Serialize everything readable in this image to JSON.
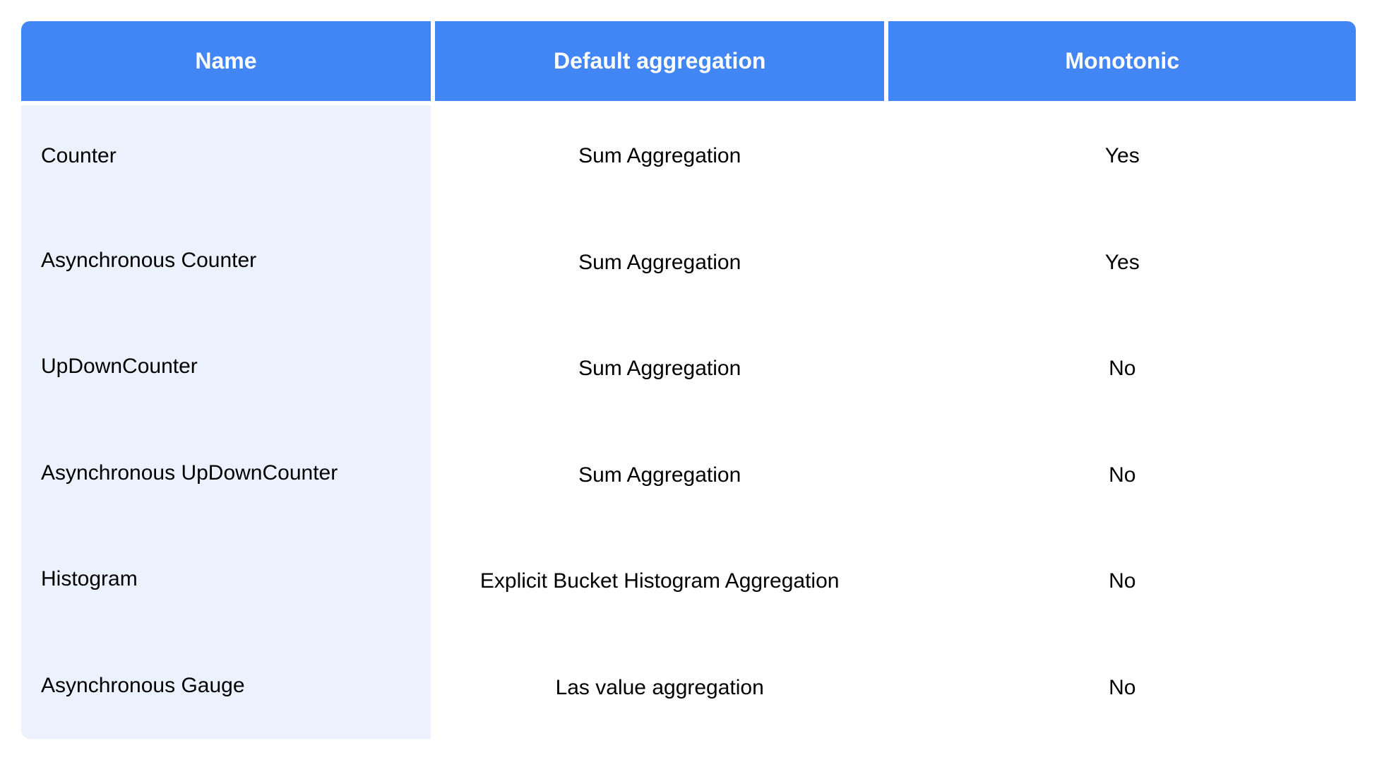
{
  "chart_data": {
    "type": "table",
    "columns": [
      "Name",
      "Default aggregation",
      "Monotonic"
    ],
    "rows": [
      [
        "Counter",
        "Sum Aggregation",
        "Yes"
      ],
      [
        "Asynchronous Counter",
        "Sum Aggregation",
        "Yes"
      ],
      [
        "UpDownCounter",
        "Sum Aggregation",
        "No"
      ],
      [
        "Asynchronous UpDownCounter",
        "Sum Aggregation",
        "No"
      ],
      [
        "Histogram",
        "Explicit Bucket Histogram Aggregation",
        "No"
      ],
      [
        "Asynchronous Gauge",
        "Las value aggregation",
        "No"
      ]
    ]
  },
  "headers": {
    "name": "Name",
    "aggregation": "Default aggregation",
    "monotonic": "Monotonic"
  },
  "rows": [
    {
      "name": "Counter",
      "aggregation": "Sum Aggregation",
      "monotonic": "Yes"
    },
    {
      "name": "Asynchronous Counter",
      "aggregation": "Sum Aggregation",
      "monotonic": "Yes"
    },
    {
      "name": "UpDownCounter",
      "aggregation": "Sum Aggregation",
      "monotonic": "No"
    },
    {
      "name": "Asynchronous UpDownCounter",
      "aggregation": "Sum Aggregation",
      "monotonic": "No"
    },
    {
      "name": "Histogram",
      "aggregation": "Explicit Bucket Histogram Aggregation",
      "monotonic": "No"
    },
    {
      "name": "Asynchronous Gauge",
      "aggregation": "Las value aggregation",
      "monotonic": "No"
    }
  ]
}
